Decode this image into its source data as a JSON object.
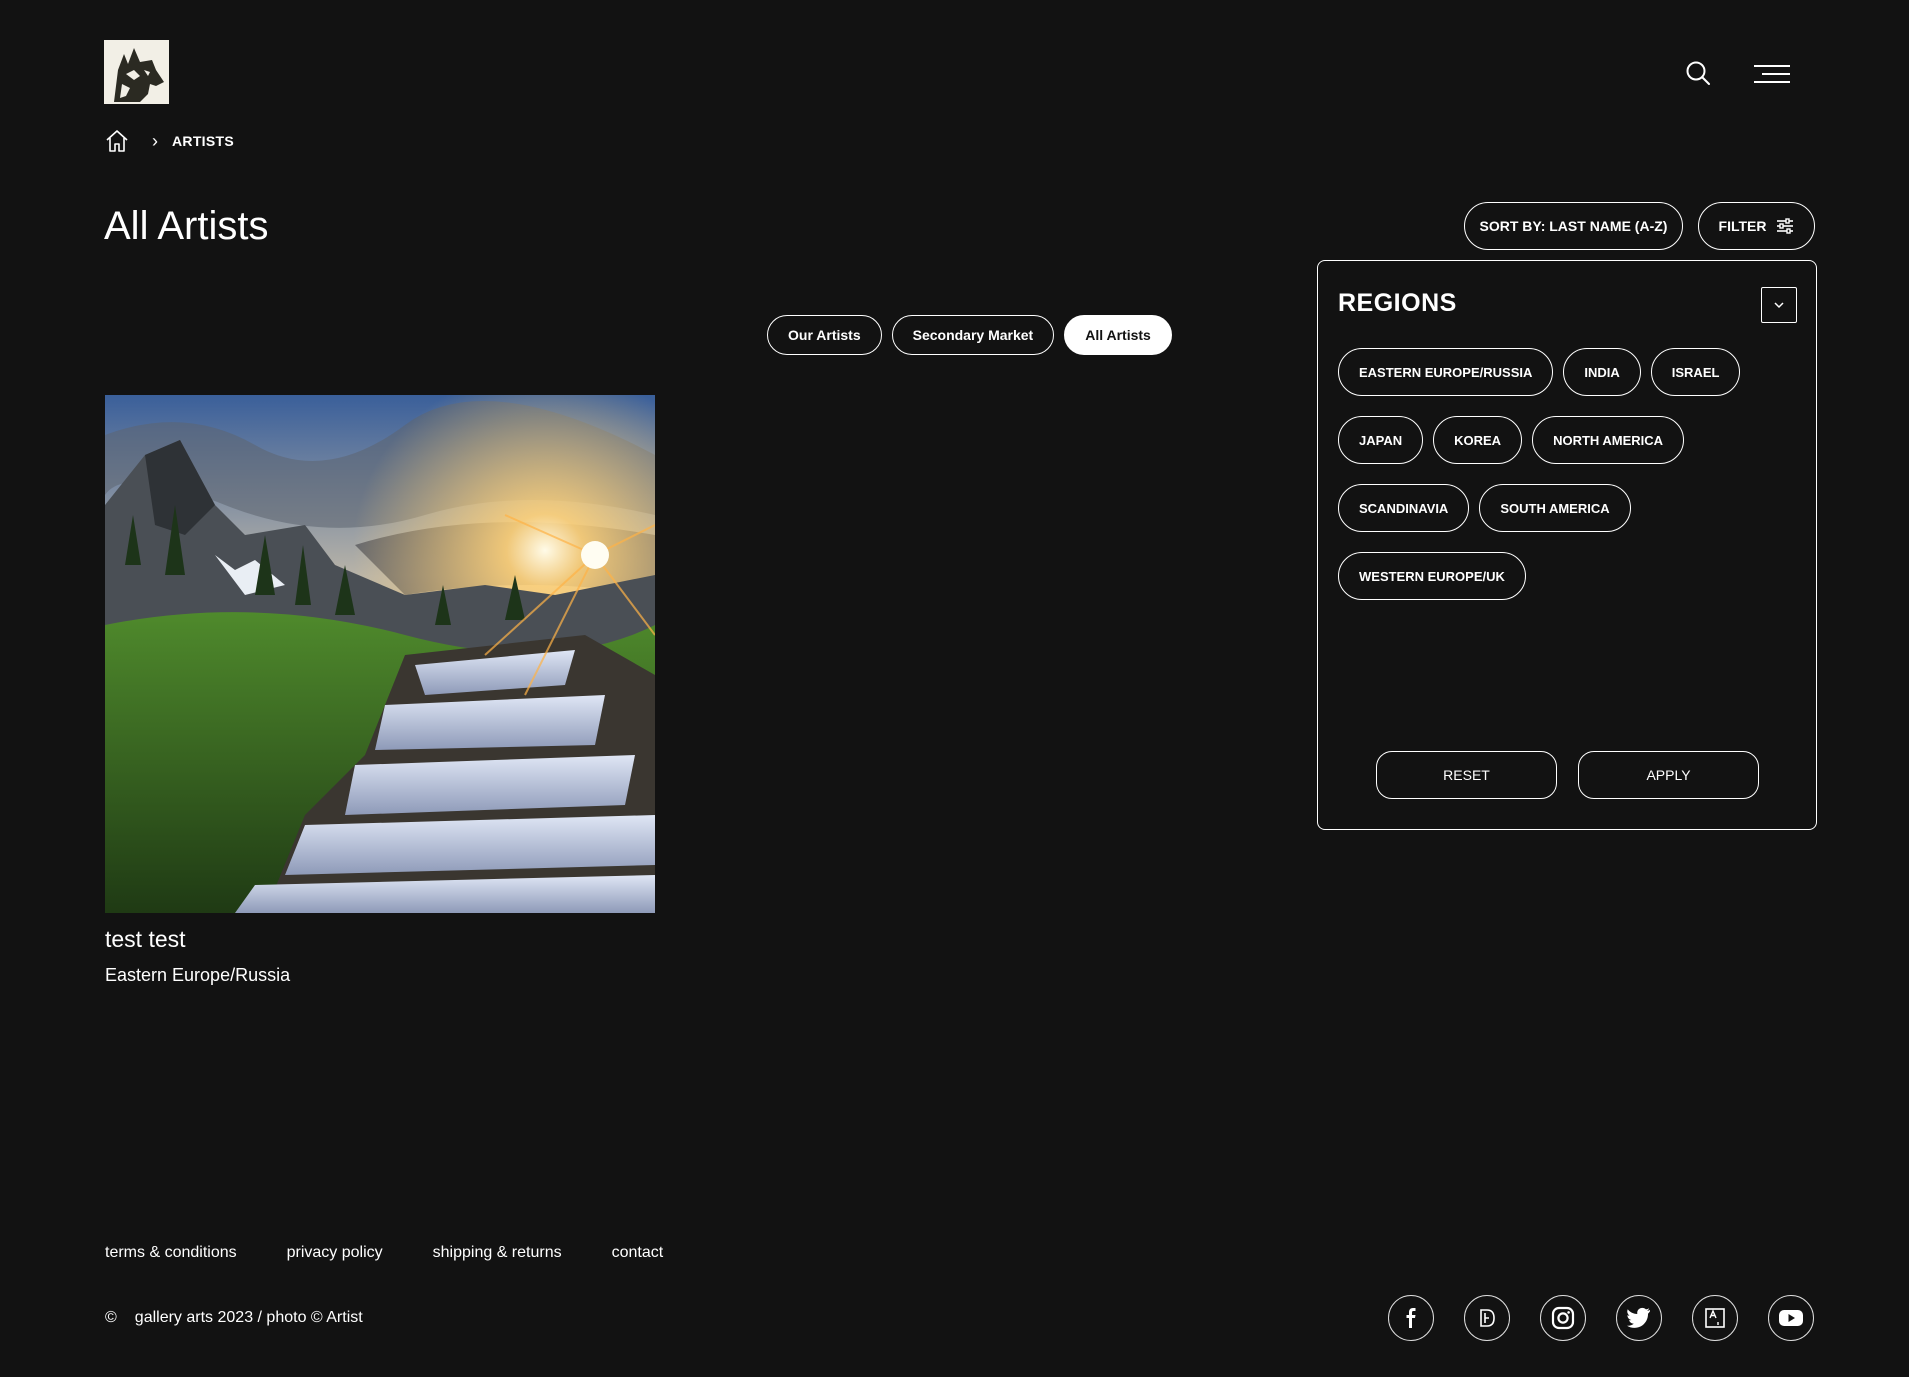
{
  "header": {
    "logo_icon": "wolf-logo-icon",
    "search_icon": "search-icon",
    "menu_icon": "hamburger-menu-icon"
  },
  "breadcrumb": {
    "home_icon": "home-icon",
    "separator": "›",
    "current": "ARTISTS"
  },
  "page": {
    "title": "All Artists"
  },
  "toolbar": {
    "sort_label": "SORT BY: LAST NAME (A-Z)",
    "filter_label": "FILTER"
  },
  "tabs": [
    {
      "label": "Our Artists",
      "active": false
    },
    {
      "label": "Secondary Market",
      "active": false
    },
    {
      "label": "All Artists",
      "active": true
    }
  ],
  "artists": [
    {
      "name": "test test",
      "region": "Eastern Europe/Russia"
    }
  ],
  "filter_panel": {
    "title": "REGIONS",
    "regions": [
      "EASTERN EUROPE/RUSSIA",
      "INDIA",
      "ISRAEL",
      "JAPAN",
      "KOREA",
      "NORTH AMERICA",
      "SCANDINAVIA",
      "SOUTH AMERICA",
      "WESTERN EUROPE/UK"
    ],
    "reset_label": "RESET",
    "apply_label": "APPLY"
  },
  "footer": {
    "links": [
      "terms & conditions",
      "privacy policy",
      "shipping & returns",
      "contact"
    ],
    "copyright_symbol": "©",
    "copyright_text": "gallery arts 2023 / photo © Artist",
    "socials": [
      "facebook-icon",
      "deviantart-icon",
      "instagram-icon",
      "twitter-icon",
      "artstation-icon",
      "youtube-icon"
    ]
  },
  "colors": {
    "background": "#121212",
    "foreground": "#ffffff"
  }
}
